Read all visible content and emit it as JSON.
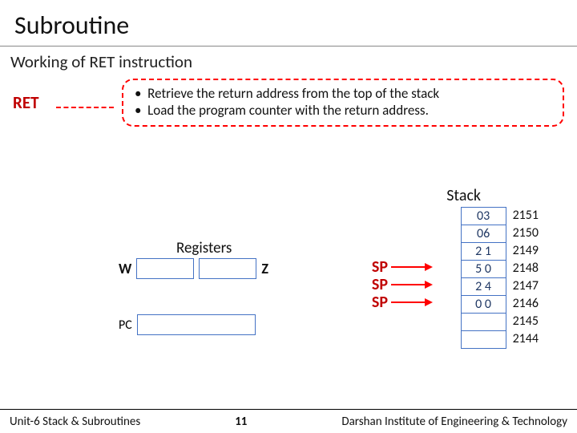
{
  "title": "Subroutine",
  "subtitle": "Working of  RET instruction",
  "ret_label": "RET",
  "info": {
    "line1": "Retrieve the return address from the top of the stack",
    "line2": "Load the program counter with the return address."
  },
  "registers": {
    "heading": "Registers",
    "w_label": "W",
    "z_label": "Z",
    "pc_label": "PC"
  },
  "sp_label": "SP",
  "stack": {
    "heading": "Stack",
    "cells": [
      "03",
      "06",
      "2 1",
      "5 0",
      "2 4",
      "0 0",
      "",
      ""
    ],
    "addresses": [
      "2151",
      "2150",
      "2149",
      "2148",
      "2147",
      "2146",
      "2145",
      "2144"
    ]
  },
  "footer": {
    "left": "Unit-6 Stack & Subroutines",
    "page": "11",
    "right": "Darshan Institute of Engineering & Technology"
  }
}
